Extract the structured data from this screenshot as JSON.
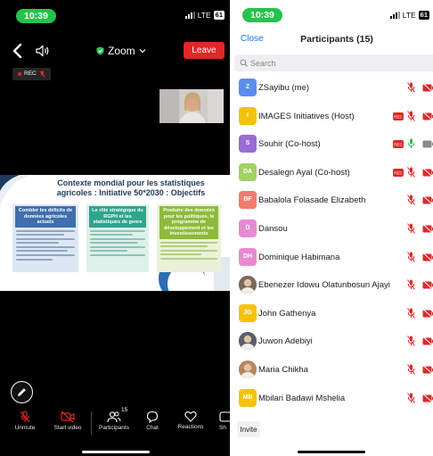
{
  "left": {
    "status": {
      "time": "10:39",
      "network": "LTE",
      "battery": "61"
    },
    "meeting": {
      "title": "Zoom",
      "leave_label": "Leave",
      "rec_label": "REC"
    },
    "slide": {
      "title": "Contexte mondial pour les statistiques agricoles : Initiative 50*2030 : Objectifs",
      "columns": [
        {
          "header": "Combler les déficits de données agricoles actuels",
          "color": "#3f6fae",
          "bg": "#dde7f4"
        },
        {
          "header": "Le rôle stratégique du RGPH et les statistiques de genre",
          "color": "#2ea58a",
          "bg": "#dcf1ea"
        },
        {
          "header": "Produire des données pour les politiques, le programme de développement et les investissements",
          "color": "#8dbb3a",
          "bg": "#e9f2d8"
        }
      ]
    },
    "toolbar": {
      "participant_count": "15",
      "items": [
        {
          "label": "Unmute",
          "icon": "mic-muted-icon"
        },
        {
          "label": "Start video",
          "icon": "video-off-icon"
        },
        {
          "label": "Participants",
          "icon": "participants-icon"
        },
        {
          "label": "Chat",
          "icon": "chat-icon"
        },
        {
          "label": "Reactions",
          "icon": "heart-icon"
        },
        {
          "label": "Sh",
          "icon": "share-icon"
        }
      ]
    }
  },
  "right": {
    "status": {
      "time": "10:39",
      "network": "LTE",
      "battery": "61"
    },
    "header": {
      "close_label": "Close",
      "title": "Participants (15)"
    },
    "search": {
      "placeholder": "Search"
    },
    "participants": [
      {
        "initials": "Z",
        "name": "ZSayibu (me)",
        "color": "#5b8def",
        "mic": "muted",
        "cam": "off",
        "rec": false
      },
      {
        "initials": "I",
        "name": "IMAGES Initiatives (Host)",
        "color": "#f4c20d",
        "mic": "muted",
        "cam": "off",
        "rec": true
      },
      {
        "initials": "S",
        "name": "Souhir (Co-host)",
        "color": "#9b6bd6",
        "mic": "live",
        "cam": "on",
        "rec": true
      },
      {
        "initials": "DA",
        "name": "Desalegn Ayal (Co-host)",
        "color": "#a3d063",
        "mic": "muted",
        "cam": "off",
        "rec": true
      },
      {
        "initials": "BF",
        "name": "Babalola Folasade Elizabeth",
        "color": "#f27b6d",
        "mic": "muted",
        "cam": "off",
        "rec": false
      },
      {
        "initials": "D",
        "name": "Dansou",
        "color": "#e68bd2",
        "mic": "muted",
        "cam": "off",
        "rec": false
      },
      {
        "initials": "DH",
        "name": "Dominique Habimana",
        "color": "#e88ad0",
        "mic": "muted",
        "cam": "off",
        "rec": false
      },
      {
        "initials": "",
        "name": "Ebenezer Idowu Olatunbosun Ajayi",
        "color": "#7a6a5c",
        "mic": "muted",
        "cam": "off",
        "rec": false
      },
      {
        "initials": "JG",
        "name": "John Gathenya",
        "color": "#f4c20d",
        "mic": "muted",
        "cam": "off",
        "rec": false
      },
      {
        "initials": "",
        "name": "Juwon Adebiyi",
        "color": "#5a5f6a",
        "mic": "muted",
        "cam": "off",
        "rec": false
      },
      {
        "initials": "",
        "name": "Maria Chikha",
        "color": "#b5865f",
        "mic": "muted",
        "cam": "off",
        "rec": false
      },
      {
        "initials": "MB",
        "name": "Mbilari Badawi Mshelia",
        "color": "#f4c20d",
        "mic": "muted",
        "cam": "off",
        "rec": false
      }
    ],
    "invite_label": "Invite"
  }
}
